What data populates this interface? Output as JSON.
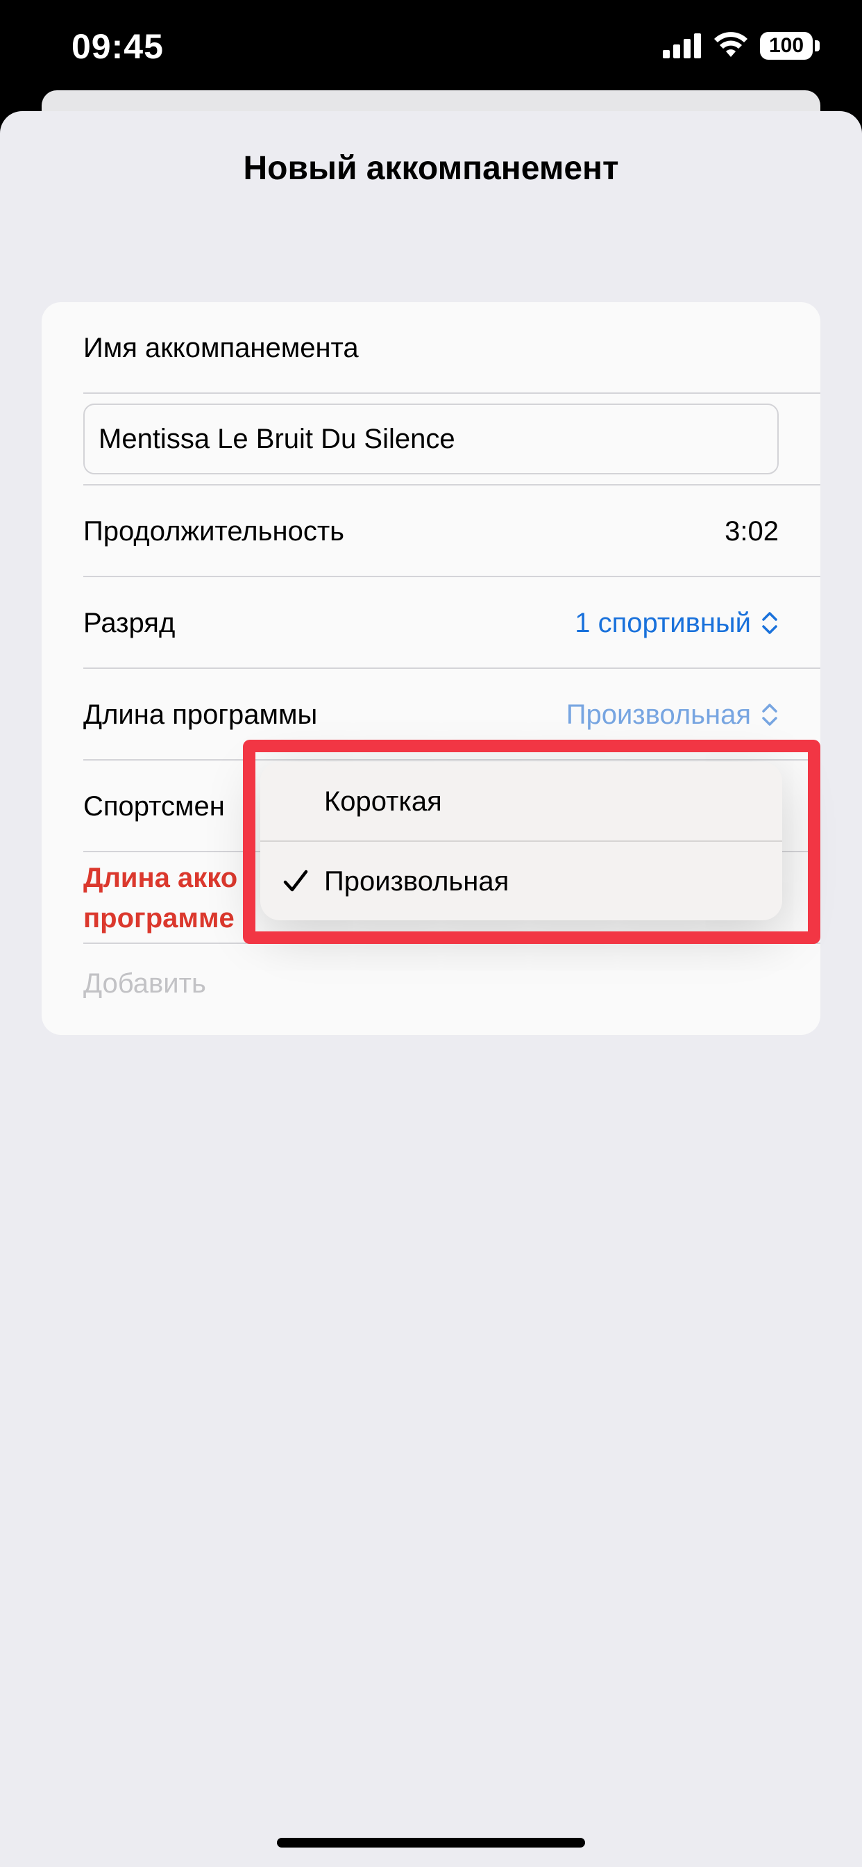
{
  "status_bar": {
    "time": "09:45",
    "battery": "100"
  },
  "sheet": {
    "title": "Новый аккомпанемент"
  },
  "form": {
    "name_label": "Имя аккомпанемента",
    "name_value": "Mentissa Le Bruit Du Silence",
    "duration_label": "Продолжительность",
    "duration_value": "3:02",
    "rank_label": "Разряд",
    "rank_value": "1 спортивный",
    "program_length_label": "Длина программы",
    "program_length_value": "Произвольная",
    "athlete_label": "Спортсмен",
    "warning_line1": "Длина акко",
    "warning_line2": "программе",
    "add_label": "Добавить"
  },
  "menu": {
    "items": [
      {
        "label": "Короткая",
        "selected": false
      },
      {
        "label": "Произвольная",
        "selected": true
      }
    ]
  },
  "colors": {
    "accent": "#1a74e0",
    "warning": "#e03a2e",
    "highlight": "#f23644"
  }
}
